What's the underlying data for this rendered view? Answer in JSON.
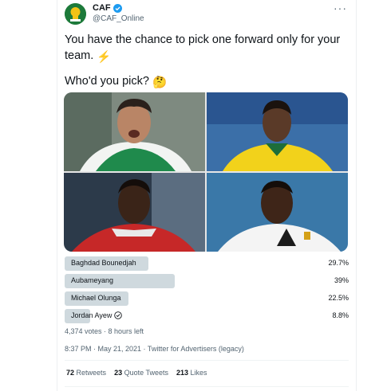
{
  "tweet": {
    "display_name": "CAF",
    "handle": "@CAF_Online",
    "text_line1": "You have the chance to pick one forward only for your team.",
    "emoji1": "⚡",
    "text_line2": "Who'd you pick?",
    "emoji2": "🤔",
    "timestamp": "8:37 PM · May 21, 2021 · Twitter for Advertisers (legacy)"
  },
  "poll": {
    "options": [
      {
        "label": "Baghdad Bounedjah",
        "percent": "29.7%",
        "value": 29.7
      },
      {
        "label": "Aubameyang",
        "percent": "39%",
        "value": 39
      },
      {
        "label": "Michael Olunga",
        "percent": "22.5%",
        "value": 22.5
      },
      {
        "label": "Jordan Ayew",
        "percent": "8.8%",
        "value": 8.8
      }
    ],
    "meta": "4,374 votes · 8 hours left"
  },
  "stats": {
    "retweets_count": "72",
    "retweets_label": "Retweets",
    "quotes_count": "23",
    "quotes_label": "Quote Tweets",
    "likes_count": "213",
    "likes_label": "Likes"
  },
  "colors": {
    "accent": "#1d9bf0",
    "poll_bar": "#cfd9de",
    "secondary_text": "#536471"
  }
}
